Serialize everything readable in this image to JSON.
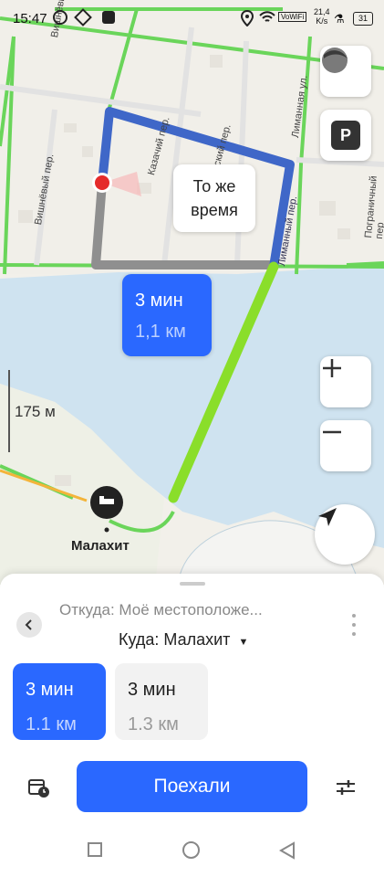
{
  "status_bar": {
    "time": "15:47",
    "data_speed": "21,4",
    "data_unit": "K/s",
    "battery": "31"
  },
  "map": {
    "streets": [
      "Вишнёвый пер.",
      "Вишнёвый пер.",
      "Казачий пер.",
      "ский пер.",
      "Лиманная ул.",
      "Лиманный пер.",
      "Пограничный пер"
    ],
    "scale_label": "175 м",
    "destination_label": "Малахит",
    "bubble_same_time": "То же время",
    "route_time": "3 мин",
    "route_distance": "1,1 км"
  },
  "colors": {
    "accent": "#2a68ff",
    "route_blue": "#3f67c8",
    "route_green": "#8ade2a",
    "water": "#cfe3f0"
  },
  "sheet": {
    "from_label": "Откуда: Моё местоположе...",
    "to_label": "Куда: Малахит",
    "routes": [
      {
        "time": "3 мин",
        "distance": "1.1 км",
        "selected": true
      },
      {
        "time": "3 мин",
        "distance": "1.3 км",
        "selected": false
      }
    ],
    "go_button": "Поехали"
  },
  "icons": {
    "back": "chevron-left-icon",
    "more": "more-vertical-icon",
    "schedule": "calendar-clock-icon",
    "settings": "sliders-icon"
  }
}
